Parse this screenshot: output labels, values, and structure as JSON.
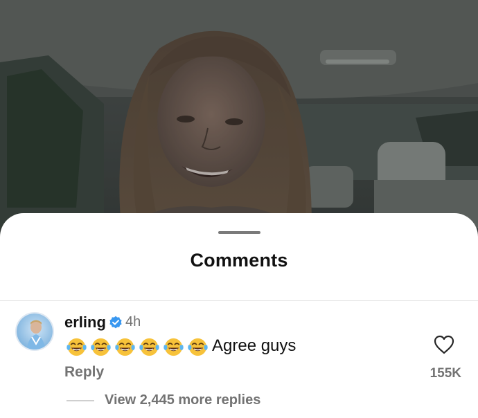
{
  "video": {
    "description_icon": "video-frame"
  },
  "comments_sheet": {
    "title": "Comments",
    "comment": {
      "username": "erling",
      "verified": true,
      "timestamp": "4h",
      "emojis": [
        "face-with-tears-of-joy",
        "face-with-tears-of-joy",
        "face-with-tears-of-joy",
        "face-with-tears-of-joy",
        "face-with-tears-of-joy",
        "face-with-tears-of-joy"
      ],
      "text": "Agree guys",
      "reply_label": "Reply",
      "like_count": "155K",
      "view_replies": "View 2,445 more replies"
    }
  },
  "colors": {
    "verified_badge": "#3897f0",
    "secondary_text": "#737373",
    "primary_text": "#111111"
  }
}
